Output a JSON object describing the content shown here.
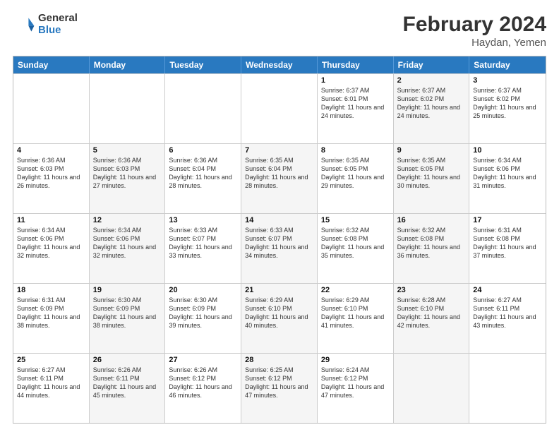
{
  "header": {
    "logo_general": "General",
    "logo_blue": "Blue",
    "month_title": "February 2024",
    "location": "Haydan, Yemen"
  },
  "weekdays": [
    "Sunday",
    "Monday",
    "Tuesday",
    "Wednesday",
    "Thursday",
    "Friday",
    "Saturday"
  ],
  "rows": [
    [
      {
        "day": "",
        "info": "",
        "shaded": false
      },
      {
        "day": "",
        "info": "",
        "shaded": false
      },
      {
        "day": "",
        "info": "",
        "shaded": false
      },
      {
        "day": "",
        "info": "",
        "shaded": false
      },
      {
        "day": "1",
        "info": "Sunrise: 6:37 AM\nSunset: 6:01 PM\nDaylight: 11 hours and 24 minutes.",
        "shaded": false
      },
      {
        "day": "2",
        "info": "Sunrise: 6:37 AM\nSunset: 6:02 PM\nDaylight: 11 hours and 24 minutes.",
        "shaded": true
      },
      {
        "day": "3",
        "info": "Sunrise: 6:37 AM\nSunset: 6:02 PM\nDaylight: 11 hours and 25 minutes.",
        "shaded": false
      }
    ],
    [
      {
        "day": "4",
        "info": "Sunrise: 6:36 AM\nSunset: 6:03 PM\nDaylight: 11 hours and 26 minutes.",
        "shaded": false
      },
      {
        "day": "5",
        "info": "Sunrise: 6:36 AM\nSunset: 6:03 PM\nDaylight: 11 hours and 27 minutes.",
        "shaded": true
      },
      {
        "day": "6",
        "info": "Sunrise: 6:36 AM\nSunset: 6:04 PM\nDaylight: 11 hours and 28 minutes.",
        "shaded": false
      },
      {
        "day": "7",
        "info": "Sunrise: 6:35 AM\nSunset: 6:04 PM\nDaylight: 11 hours and 28 minutes.",
        "shaded": true
      },
      {
        "day": "8",
        "info": "Sunrise: 6:35 AM\nSunset: 6:05 PM\nDaylight: 11 hours and 29 minutes.",
        "shaded": false
      },
      {
        "day": "9",
        "info": "Sunrise: 6:35 AM\nSunset: 6:05 PM\nDaylight: 11 hours and 30 minutes.",
        "shaded": true
      },
      {
        "day": "10",
        "info": "Sunrise: 6:34 AM\nSunset: 6:06 PM\nDaylight: 11 hours and 31 minutes.",
        "shaded": false
      }
    ],
    [
      {
        "day": "11",
        "info": "Sunrise: 6:34 AM\nSunset: 6:06 PM\nDaylight: 11 hours and 32 minutes.",
        "shaded": false
      },
      {
        "day": "12",
        "info": "Sunrise: 6:34 AM\nSunset: 6:06 PM\nDaylight: 11 hours and 32 minutes.",
        "shaded": true
      },
      {
        "day": "13",
        "info": "Sunrise: 6:33 AM\nSunset: 6:07 PM\nDaylight: 11 hours and 33 minutes.",
        "shaded": false
      },
      {
        "day": "14",
        "info": "Sunrise: 6:33 AM\nSunset: 6:07 PM\nDaylight: 11 hours and 34 minutes.",
        "shaded": true
      },
      {
        "day": "15",
        "info": "Sunrise: 6:32 AM\nSunset: 6:08 PM\nDaylight: 11 hours and 35 minutes.",
        "shaded": false
      },
      {
        "day": "16",
        "info": "Sunrise: 6:32 AM\nSunset: 6:08 PM\nDaylight: 11 hours and 36 minutes.",
        "shaded": true
      },
      {
        "day": "17",
        "info": "Sunrise: 6:31 AM\nSunset: 6:08 PM\nDaylight: 11 hours and 37 minutes.",
        "shaded": false
      }
    ],
    [
      {
        "day": "18",
        "info": "Sunrise: 6:31 AM\nSunset: 6:09 PM\nDaylight: 11 hours and 38 minutes.",
        "shaded": false
      },
      {
        "day": "19",
        "info": "Sunrise: 6:30 AM\nSunset: 6:09 PM\nDaylight: 11 hours and 38 minutes.",
        "shaded": true
      },
      {
        "day": "20",
        "info": "Sunrise: 6:30 AM\nSunset: 6:09 PM\nDaylight: 11 hours and 39 minutes.",
        "shaded": false
      },
      {
        "day": "21",
        "info": "Sunrise: 6:29 AM\nSunset: 6:10 PM\nDaylight: 11 hours and 40 minutes.",
        "shaded": true
      },
      {
        "day": "22",
        "info": "Sunrise: 6:29 AM\nSunset: 6:10 PM\nDaylight: 11 hours and 41 minutes.",
        "shaded": false
      },
      {
        "day": "23",
        "info": "Sunrise: 6:28 AM\nSunset: 6:10 PM\nDaylight: 11 hours and 42 minutes.",
        "shaded": true
      },
      {
        "day": "24",
        "info": "Sunrise: 6:27 AM\nSunset: 6:11 PM\nDaylight: 11 hours and 43 minutes.",
        "shaded": false
      }
    ],
    [
      {
        "day": "25",
        "info": "Sunrise: 6:27 AM\nSunset: 6:11 PM\nDaylight: 11 hours and 44 minutes.",
        "shaded": false
      },
      {
        "day": "26",
        "info": "Sunrise: 6:26 AM\nSunset: 6:11 PM\nDaylight: 11 hours and 45 minutes.",
        "shaded": true
      },
      {
        "day": "27",
        "info": "Sunrise: 6:26 AM\nSunset: 6:12 PM\nDaylight: 11 hours and 46 minutes.",
        "shaded": false
      },
      {
        "day": "28",
        "info": "Sunrise: 6:25 AM\nSunset: 6:12 PM\nDaylight: 11 hours and 47 minutes.",
        "shaded": true
      },
      {
        "day": "29",
        "info": "Sunrise: 6:24 AM\nSunset: 6:12 PM\nDaylight: 11 hours and 47 minutes.",
        "shaded": false
      },
      {
        "day": "",
        "info": "",
        "shaded": true
      },
      {
        "day": "",
        "info": "",
        "shaded": false
      }
    ]
  ]
}
